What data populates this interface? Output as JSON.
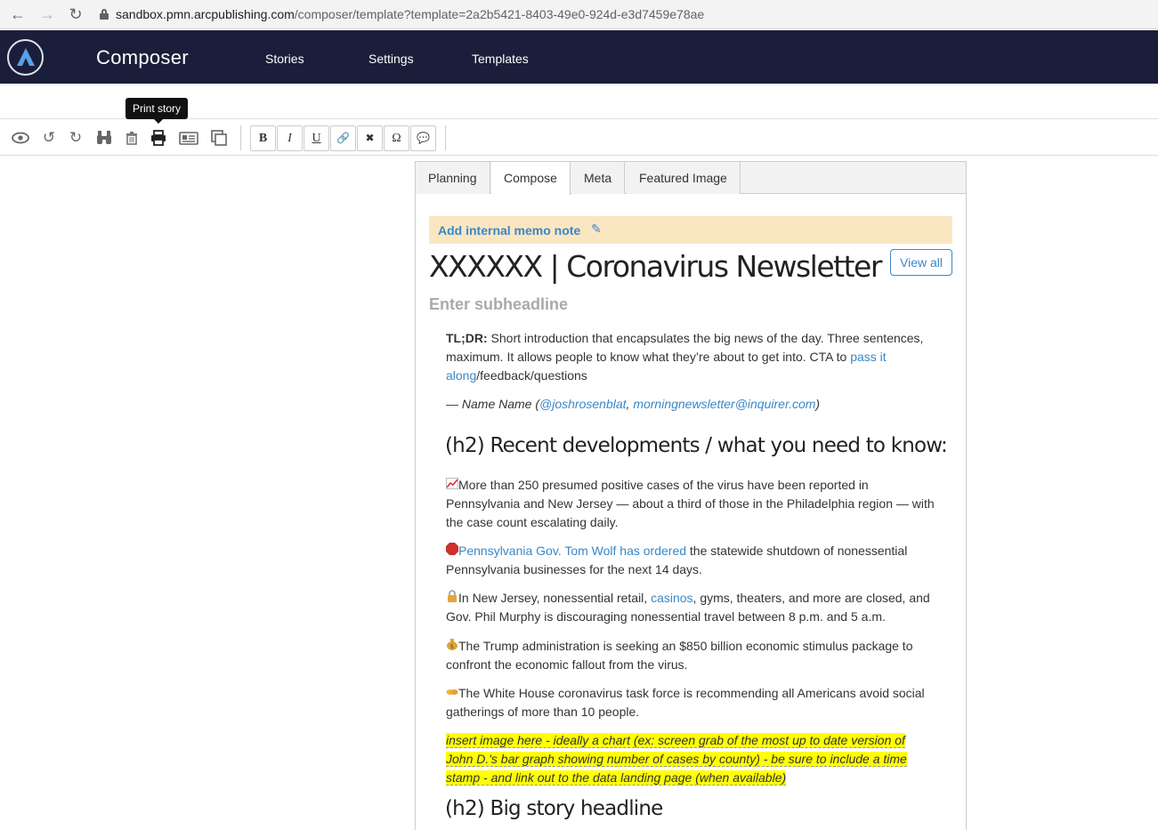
{
  "browser": {
    "url_host": "sandbox.pmn.arcpublishing.com",
    "url_path": "/composer/template?template=2a2b5421-8403-49e0-924d-e3d7459e78ae"
  },
  "app": {
    "title": "Composer",
    "nav": [
      "Stories",
      "Settings",
      "Templates"
    ]
  },
  "toolbar": {
    "tooltip": "Print story",
    "format_buttons": [
      "B",
      "I",
      "U",
      "🔗",
      "✖",
      "Ω",
      "💬"
    ]
  },
  "tabs": [
    "Planning",
    "Compose",
    "Meta",
    "Featured Image"
  ],
  "active_tab": "Compose",
  "editor": {
    "memo_label": "Add internal memo note",
    "headline": "XXXXXX | Coronavirus Newsletter",
    "view_all": "View all",
    "subheadline_placeholder": "Enter subheadline",
    "intro_label": "TL;DR:",
    "intro_text": " Short introduction that encapsulates the big news of the day. Three sentences, maximum. It allows people to know what they’re about to get into. CTA to ",
    "intro_link": "pass it along",
    "intro_tail": "/feedback/questions",
    "byline_prefix": "— Name Name (",
    "byline_handle": "@joshrosenblat",
    "byline_sep": ", ",
    "byline_email": "morningnewsletter@inquirer.com",
    "byline_suffix": ")",
    "h2_recent": "(h2) Recent developments / what you need to know:",
    "item1": "More than 250 presumed positive cases of the virus have been reported in Pennsylvania and New Jersey — about a third of those in the Philadelphia region — with the case count escalating daily.",
    "item2_link": "Pennsylvania Gov. Tom Wolf has ordered",
    "item2_rest": " the statewide shutdown of nonessential Pennsylvania businesses for the next 14 days.",
    "item3_a": "In New Jersey, nonessential retail, ",
    "item3_link": "casinos",
    "item3_b": ", gyms, theaters, and more are closed, and Gov. Phil Murphy is discouraging nonessential travel between 8 p.m. and 5 a.m.",
    "item4": "The Trump administration is seeking an $850 billion economic stimulus package to confront the economic fallout from the virus.",
    "item5": "The White House coronavirus task force is recommending all Americans avoid social gatherings of more than 10 people.",
    "note": "insert image here - ideally a chart (ex: screen grab of the most up to date version of John D.'s bar graph showing number of cases by county) - be sure to include a time stamp - and link out to the data landing page (when available)",
    "h2_big": "(h2) Big story headline"
  }
}
